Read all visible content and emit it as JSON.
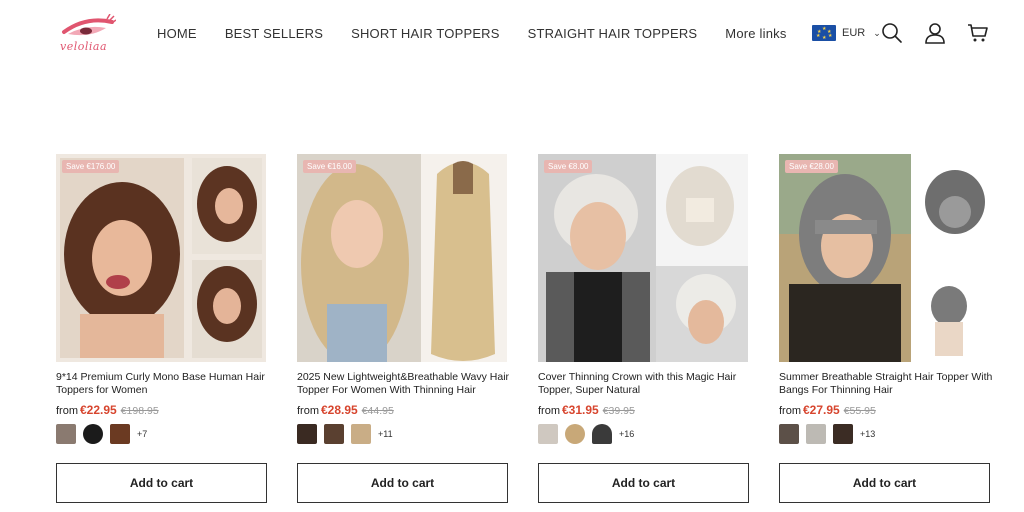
{
  "brand": {
    "logo_text": "veloliaa"
  },
  "nav": [
    "HOME",
    "BEST SELLERS",
    "SHORT HAIR TOPPERS",
    "STRAIGHT HAIR TOPPERS",
    "More links"
  ],
  "currency": {
    "code": "EUR"
  },
  "icons": {
    "search": "search-icon",
    "account": "account-icon",
    "cart": "cart-icon",
    "flag": "eu-flag-icon"
  },
  "colors": {
    "sale_price": "#d7452e",
    "badge": "#e8b6b1",
    "logo": "#e0556f"
  },
  "products": [
    {
      "badge": "Save €176.00",
      "title": "9*14 Premium Curly Mono Base Human Hair Toppers for Women",
      "from": "from",
      "price": "€22.95",
      "compare": "€198.95",
      "more": "+7",
      "button": "Add to cart"
    },
    {
      "badge": "Save €16.00",
      "title": "2025 New Lightweight&Breathable Wavy Hair Topper For Women With Thinning Hair",
      "from": "from",
      "price": "€28.95",
      "compare": "€44.95",
      "more": "+11",
      "button": "Add to cart"
    },
    {
      "badge": "Save €8.00",
      "title": "Cover Thinning Crown with this Magic Hair Topper, Super Natural",
      "from": "from",
      "price": "€31.95",
      "compare": "€39.95",
      "more": "+16",
      "button": "Add to cart"
    },
    {
      "badge": "Save €28.00",
      "title": "Summer Breathable Straight Hair Topper With Bangs For Thinning Hair",
      "from": "from",
      "price": "€27.95",
      "compare": "€55.95",
      "more": "+13",
      "button": "Add to cart"
    }
  ]
}
